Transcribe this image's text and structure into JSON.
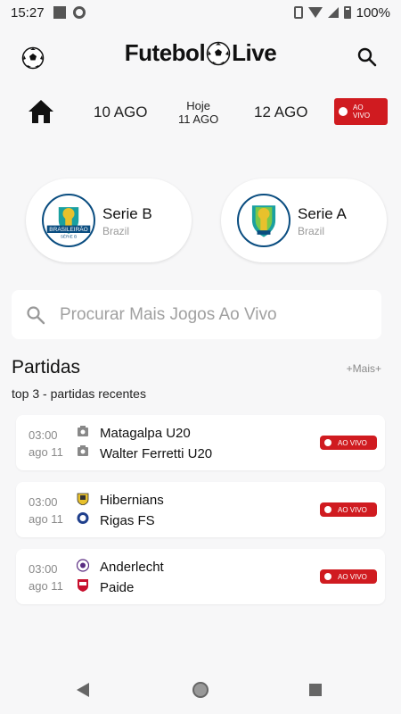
{
  "status_bar": {
    "time": "15:27",
    "battery": "100%"
  },
  "header": {
    "logo_left": "Futebol",
    "logo_right": "Live"
  },
  "dates": {
    "prev": "10 AGO",
    "today_label": "Hoje",
    "today_date": "11 AGO",
    "next": "12 AGO",
    "live_label_1": "AO",
    "live_label_2": "VIVO"
  },
  "leagues": [
    {
      "name": "Serie B",
      "country": "Brazil",
      "crest_text_1": "BRASILEIRÃO",
      "crest_text_2": "SÉRIE B"
    },
    {
      "name": "Serie A",
      "country": "Brazil"
    }
  ],
  "search": {
    "placeholder": "Procurar Mais Jogos Ao Vivo"
  },
  "section": {
    "title": "Partidas",
    "more": "+Mais+",
    "subtitle": "top 3 - partidas recentes"
  },
  "matches": [
    {
      "time": "03:00",
      "date": "ago 11",
      "home": "Matagalpa U20",
      "away": "Walter Ferretti U20",
      "live": "AO VIVO"
    },
    {
      "time": "03:00",
      "date": "ago 11",
      "home": "Hibernians",
      "away": "Rigas FS",
      "live": "AO VIVO"
    },
    {
      "time": "03:00",
      "date": "ago 11",
      "home": "Anderlecht",
      "away": "Paide",
      "live": "AO VIVO"
    }
  ],
  "colors": {
    "accent_red": "#d01b20",
    "background": "#f7f7f8"
  }
}
